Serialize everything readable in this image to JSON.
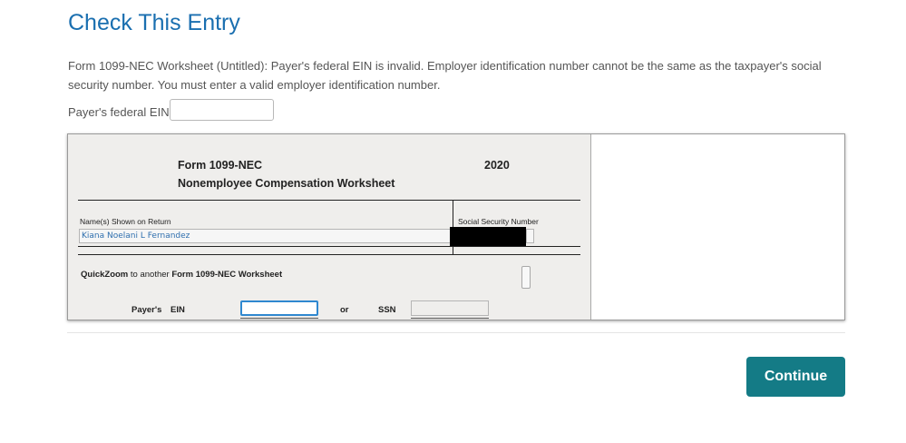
{
  "header": {
    "title": "Check This Entry"
  },
  "error": {
    "message": "Form 1099-NEC Worksheet (Untitled): Payer's federal EIN is invalid. Employer identification number cannot be the same as the taxpayer's social security number. You must enter a valid employer identification number."
  },
  "ein_entry": {
    "label": "Payer's federal EIN",
    "value": ""
  },
  "form": {
    "title_line1": "Form 1099-NEC",
    "title_line2": "Nonemployee Compensation Worksheet",
    "year": "2020",
    "name_label": "Name(s) Shown on Return",
    "name_value": "Kiana Noelani L Fernandez",
    "ssn_label": "Social Security Number",
    "quickzoom_bold": "QuickZoom",
    "quickzoom_mid": " to another ",
    "quickzoom_tail": "Form 1099-NEC Worksheet",
    "payer_label": "Payer's",
    "ein_label": "EIN",
    "or_label": "or",
    "ssn_short_label": "SSN"
  },
  "actions": {
    "continue_label": "Continue"
  },
  "colors": {
    "title": "#1a6fb0",
    "continue_bg": "#147b86",
    "form_bg": "#efeeec",
    "focused_field": "#2f88d0",
    "redaction": "#000000"
  }
}
